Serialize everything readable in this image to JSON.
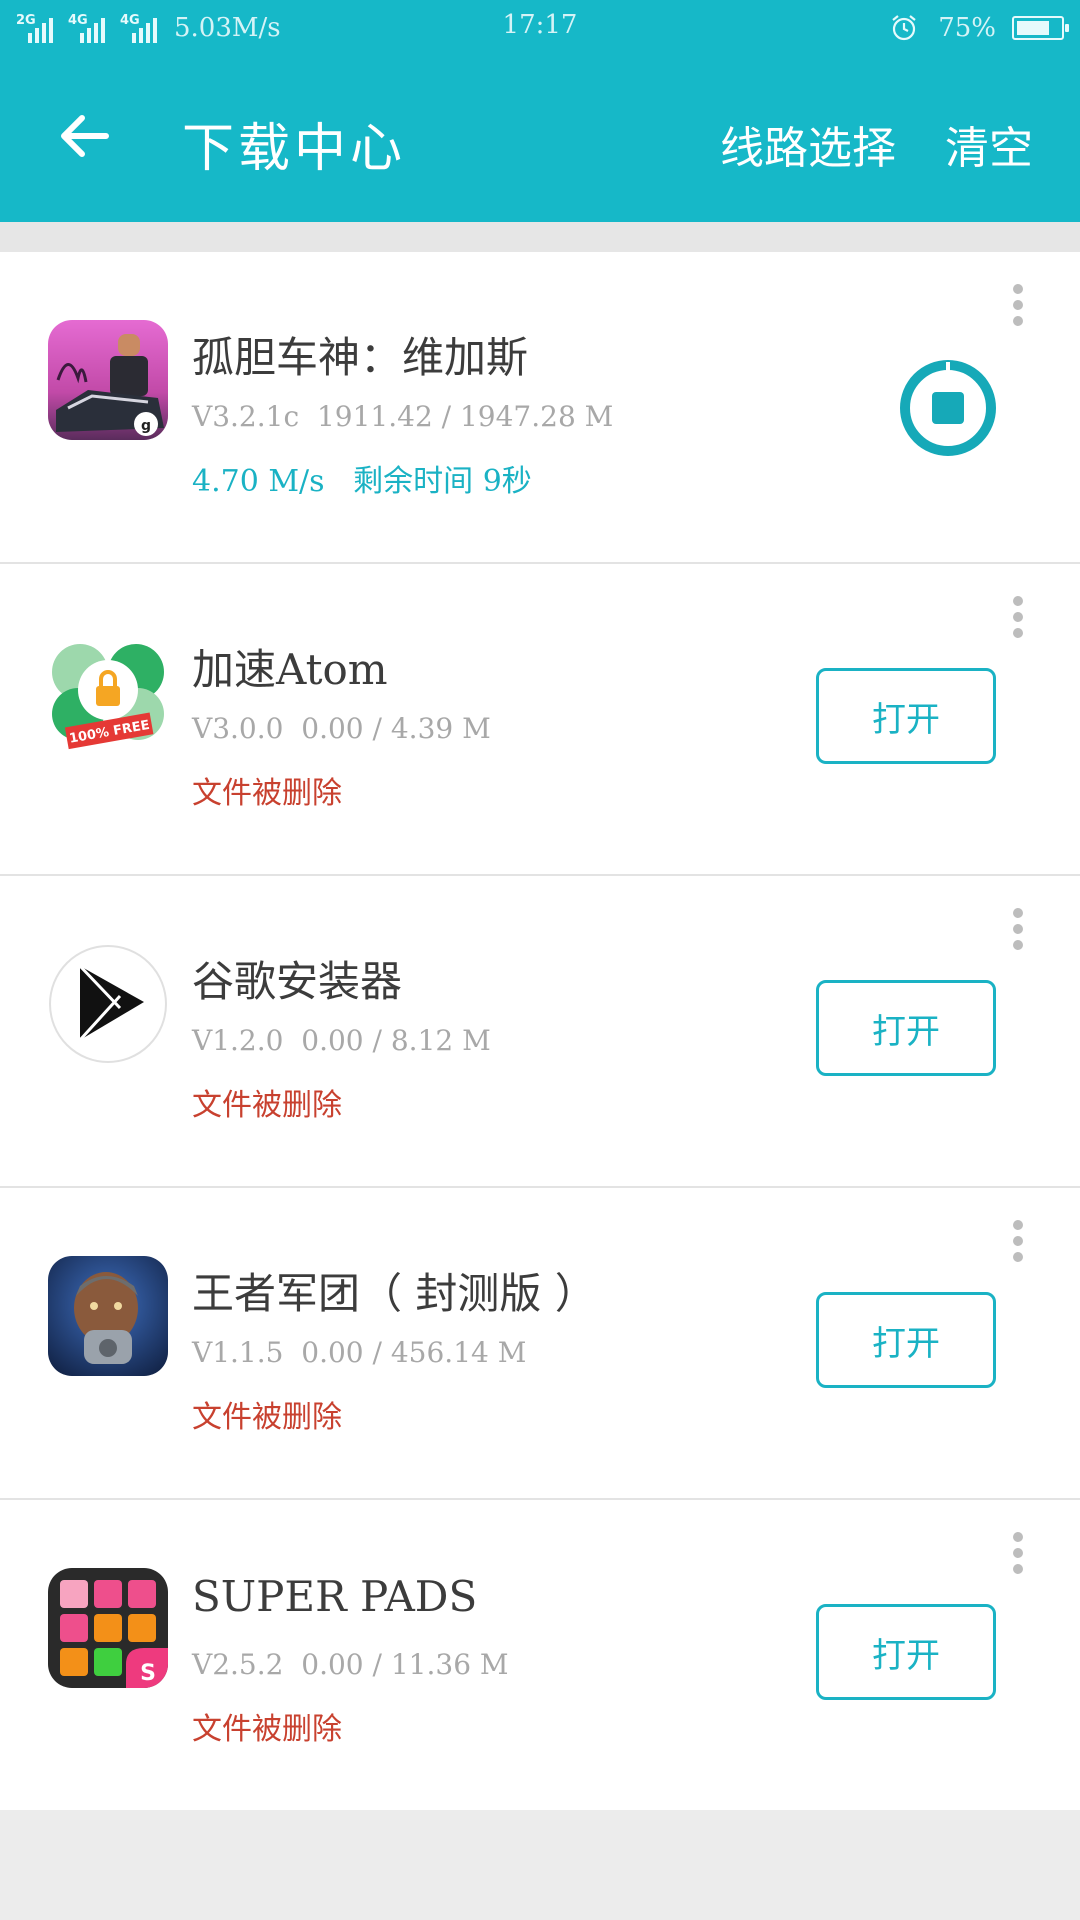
{
  "status_bar": {
    "sim1": "2G",
    "sim2": "4G",
    "sim3": "4G",
    "speed": "5.03M/s",
    "time": "17:17",
    "battery": "75%",
    "battery_level": 0.75
  },
  "header": {
    "title": "下载中心",
    "route_label": "线路选择",
    "clear_label": "清空"
  },
  "colors": {
    "accent": "#16b8c8",
    "deleted_red": "#c8412f"
  },
  "items": [
    {
      "name": "孤胆车神：维加斯",
      "version": "V3.2.1c",
      "progress": "1911.42 / 1947.28 M",
      "speed": "4.70 M/s",
      "remaining": "剩余时间 9秒",
      "icon": "gangstar-vegas-icon",
      "action": "pause"
    },
    {
      "name": "加速Atom",
      "version": "V3.0.0",
      "progress": "0.00 / 4.39 M",
      "status": "文件被删除",
      "icon": "atom-vpn-icon",
      "icon_text": "100% FREE",
      "action_label": "打开"
    },
    {
      "name": "谷歌安装器",
      "version": "V1.2.0",
      "progress": "0.00 / 8.12 M",
      "status": "文件被删除",
      "icon": "play-store-icon",
      "action_label": "打开"
    },
    {
      "name": "王者军团（ 封测版 ）",
      "version": "V1.1.5",
      "progress": "0.00 / 456.14 M",
      "status": "文件被删除",
      "icon": "soldier-game-icon",
      "action_label": "打开"
    },
    {
      "name": "SUPER PADS",
      "version": "V2.5.2",
      "progress": "0.00 / 11.36 M",
      "status": "文件被删除",
      "icon": "super-pads-icon",
      "icon_text": "S",
      "action_label": "打开"
    }
  ]
}
